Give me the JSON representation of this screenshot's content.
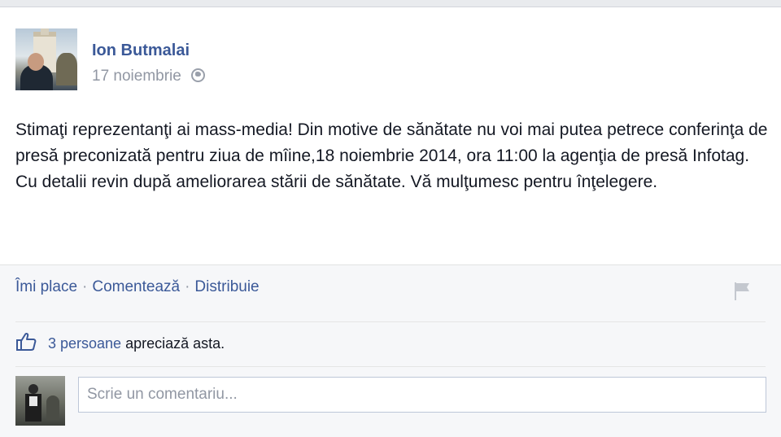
{
  "post": {
    "author": "Ion Butmalai",
    "date": "17 noiembrie",
    "privacy_icon": "globe-icon",
    "text": "Stimaţi reprezentanţi ai mass-media! Din motive de sănătate nu voi mai putea petrece conferinţa de presă preconizată pentru ziua de mîine,18 noiembrie 2014, ora 11:00 la agenţia de presă Infotag. Cu detalii revin după ameliorarea stării de sănătate. Vă mulţumesc pentru înţelegere."
  },
  "actions": {
    "like": "Îmi place",
    "comment": "Comentează",
    "share": "Distribuie",
    "separator": "·"
  },
  "likes": {
    "icon": "thumbs-up-icon",
    "count_text": "3 persoane",
    "rest_text": " apreciază asta."
  },
  "comment_box": {
    "placeholder": "Scrie un comentariu..."
  },
  "colors": {
    "link": "#3b5998",
    "muted": "#9197a3",
    "text": "#141823"
  }
}
